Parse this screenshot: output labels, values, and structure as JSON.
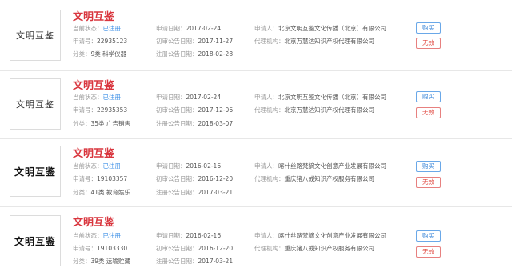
{
  "labels": {
    "status": "当前状态：",
    "reg_no": "申请号：",
    "category": "分类：",
    "apply_date": "申请日期：",
    "first_notice": "初审公告日期：",
    "reg_notice": "注册公告日期：",
    "applicant": "申请人：",
    "agency": "代理机构："
  },
  "items": [
    {
      "logo_text": "文明互鉴",
      "name": "文明互鉴",
      "status": "已注册",
      "reg_no": "22935123",
      "category": "9类 科学仪器",
      "apply_date": "2017-02-24",
      "first_notice": "2017-11-27",
      "reg_notice": "2018-02-28",
      "applicant": "北京文明互鉴文化传播（北京）有限公司",
      "agency": "北京万慧达知识产权代理有限公司",
      "buy_label": "购买",
      "invalid_label": "无效"
    },
    {
      "logo_text": "文明互鉴",
      "name": "文明互鉴",
      "status": "已注册",
      "reg_no": "22935353",
      "category": "35类 广告销售",
      "apply_date": "2017-02-24",
      "first_notice": "2017-12-06",
      "reg_notice": "2018-03-07",
      "applicant": "北京文明互鉴文化传播（北京）有限公司",
      "agency": "北京万慧达知识产权代理有限公司",
      "buy_label": "购买",
      "invalid_label": "无效"
    },
    {
      "logo_text": "文明互鉴",
      "name": "文明互鉴",
      "status": "已注册",
      "reg_no": "19103357",
      "category": "41类 教育娱乐",
      "apply_date": "2016-02-16",
      "first_notice": "2016-12-20",
      "reg_notice": "2017-03-21",
      "applicant": "喀什丝路梵嫡文化创意产业发展有限公司",
      "agency": "重庆猪八戒知识产权服务有限公司",
      "buy_label": "购买",
      "invalid_label": "无效"
    },
    {
      "logo_text": "文明互鉴",
      "name": "文明互鉴",
      "status": "已注册",
      "reg_no": "19103330",
      "category": "39类 运输贮藏",
      "apply_date": "2016-02-16",
      "first_notice": "2016-12-20",
      "reg_notice": "2017-03-21",
      "applicant": "喀什丝路梵嫡文化创意产业发展有限公司",
      "agency": "重庆猪八戒知识产权服务有限公司",
      "buy_label": "购买",
      "invalid_label": "无效"
    }
  ]
}
